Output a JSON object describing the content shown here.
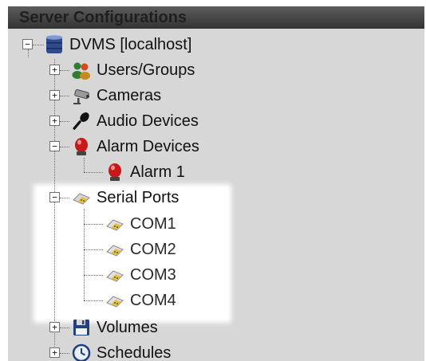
{
  "panel": {
    "title": "Server Configurations"
  },
  "tree": {
    "root": "DVMS [localhost]",
    "users": "Users/Groups",
    "cameras": "Cameras",
    "audio": "Audio Devices",
    "alarm_devices": "Alarm Devices",
    "alarm1": "Alarm 1",
    "serial_ports": "Serial Ports",
    "com1": "COM1",
    "com2": "COM2",
    "com3": "COM3",
    "com4": "COM4",
    "volumes": "Volumes",
    "schedules": "Schedules",
    "expand_glyph": "+",
    "collapse_glyph": "−"
  },
  "colors": {
    "highlight": "#ffffff",
    "panel_bg": "#d7d7d7",
    "title_bar": "#3c3c3c"
  }
}
